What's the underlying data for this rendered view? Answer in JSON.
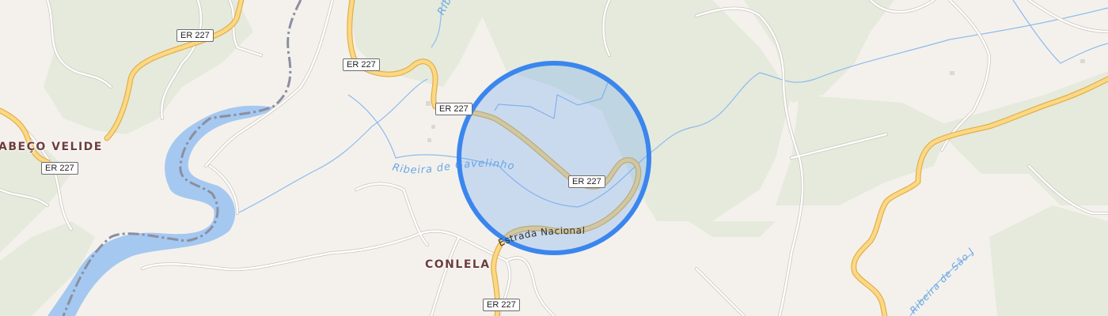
{
  "map": {
    "colors": {
      "background": "#f4f1ec",
      "forest": "#e5eadc",
      "water": "#a5c8f1",
      "stream": "#8cbbee",
      "road_primary_casing": "#e2b14a",
      "road_primary_fill": "#fcd886",
      "road_minor": "#ffffff",
      "boundary": "#8a8fa0",
      "selection_fill": "#5f9df5",
      "selection_stroke": "#3b86ee"
    },
    "road_shields": [
      {
        "id": "nw",
        "text": "ER 227"
      },
      {
        "id": "top-mid",
        "text": "ER 227"
      },
      {
        "id": "left",
        "text": "ER 227"
      },
      {
        "id": "center",
        "text": "ER 227"
      },
      {
        "id": "circle",
        "text": "ER 227"
      },
      {
        "id": "bottom",
        "text": "ER 227"
      }
    ],
    "places": {
      "cabeco_velide": "ABEÇO VELIDE",
      "conlela": "CONLELA"
    },
    "water_labels": {
      "ribeira_gavelinho": "Ribeira de Gavelinho",
      "ribeira_top": "Ribeira",
      "ribeira_sao_joao": "Ribeira de São João"
    },
    "road_labels": {
      "estrada_nacional": "Estrada Nacional 227"
    },
    "selection": {
      "shape": "circle"
    }
  }
}
